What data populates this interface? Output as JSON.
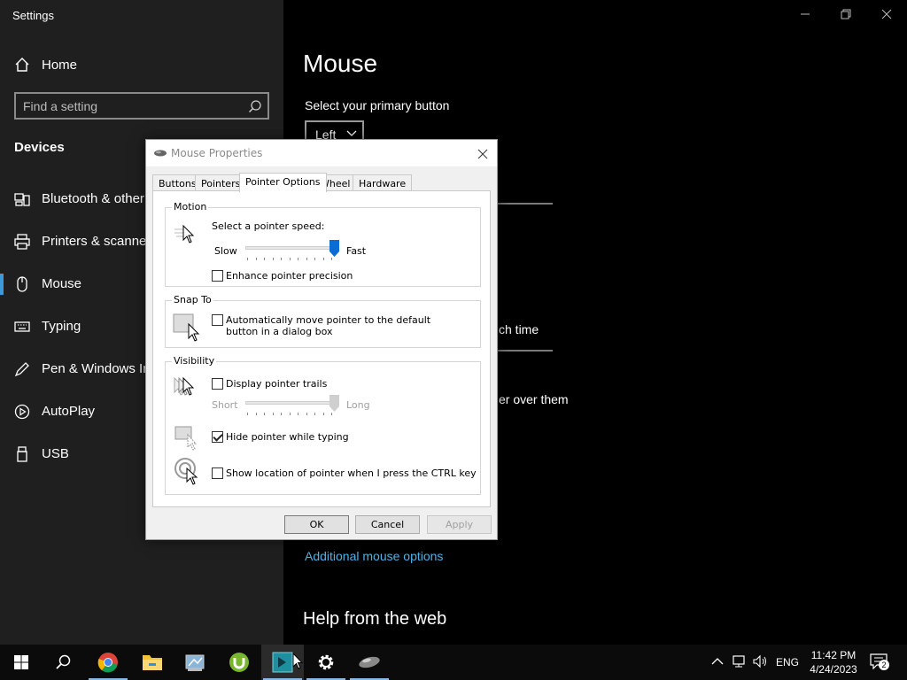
{
  "settings": {
    "app_title": "Settings",
    "home_label": "Home",
    "search_placeholder": "Find a setting",
    "section_title": "Devices",
    "nav_items": [
      {
        "label": "Bluetooth & other devices",
        "icon": "bluetooth-device-icon"
      },
      {
        "label": "Printers & scanners",
        "icon": "printer-icon"
      },
      {
        "label": "Mouse",
        "icon": "mouse-icon",
        "selected": true
      },
      {
        "label": "Typing",
        "icon": "keyboard-icon"
      },
      {
        "label": "Pen & Windows Ink",
        "icon": "pen-icon"
      },
      {
        "label": "AutoPlay",
        "icon": "autoplay-icon"
      },
      {
        "label": "USB",
        "icon": "usb-icon"
      }
    ],
    "page_title": "Mouse",
    "primary_button_label": "Select your primary button",
    "primary_button_value": "Left",
    "partial_text_1": "ch time",
    "partial_text_2": "er over them",
    "additional_link": "Additional mouse options",
    "help_title": "Help from the web",
    "accent_color": "#3a9bd8",
    "link_color": "#4fb3e8"
  },
  "dialog": {
    "title": "Mouse Properties",
    "tabs": [
      "Buttons",
      "Pointers",
      "Pointer Options",
      "Wheel",
      "Hardware"
    ],
    "active_tab": "Pointer Options",
    "motion": {
      "group_title": "Motion",
      "speed_label": "Select a pointer speed:",
      "slow": "Slow",
      "fast": "Fast",
      "speed_value": 1.0,
      "enhance_label": "Enhance pointer precision",
      "enhance_checked": false
    },
    "snap_to": {
      "group_title": "Snap To",
      "label": "Automatically move pointer to the default button in a dialog box",
      "checked": false
    },
    "visibility": {
      "group_title": "Visibility",
      "trails_label": "Display pointer trails",
      "trails_checked": false,
      "short": "Short",
      "long": "Long",
      "trails_value": 1.0,
      "hide_label": "Hide pointer while typing",
      "hide_checked": true,
      "ctrl_label": "Show location of pointer when I press the CTRL key",
      "ctrl_checked": false
    },
    "buttons": {
      "ok": "OK",
      "cancel": "Cancel",
      "apply": "Apply"
    }
  },
  "taskbar": {
    "apps": [
      "start-icon",
      "search-icon",
      "chrome-icon",
      "file-explorer-icon",
      "control-panel-icon",
      "utorrent-icon",
      "terminal-app-icon",
      "settings-gear-icon",
      "mouse-properties-icon"
    ],
    "language": "ENG",
    "time": "11:42 PM",
    "date": "4/24/2023",
    "notification_count": "2"
  }
}
